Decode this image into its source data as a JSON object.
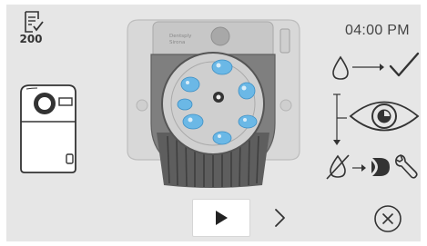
{
  "header": {
    "counter_icon": "checklist-icon",
    "counter_value": "200",
    "time": "04:00 PM"
  },
  "device": {
    "icon": "device-icon"
  },
  "machine": {
    "icon": "cleaning-unit-image",
    "brand_line1": "Dentsply",
    "brand_line2": "Sirona"
  },
  "status_flow": {
    "drop_icon": "water-drop-icon",
    "check_icon": "checkmark-icon",
    "eye_icon": "eye-icon",
    "nodrop_icon": "no-water-drop-icon",
    "logo_icon": "dentsply-sirona-logo-icon",
    "wrench_icon": "wrench-icon"
  },
  "controls": {
    "play_icon": "play-icon",
    "next_icon": "chevron-right-icon",
    "close_icon": "close-circle-icon"
  },
  "colors": {
    "background": "#e6e6e6",
    "icon": "#333333",
    "water": "#5aaee0"
  }
}
